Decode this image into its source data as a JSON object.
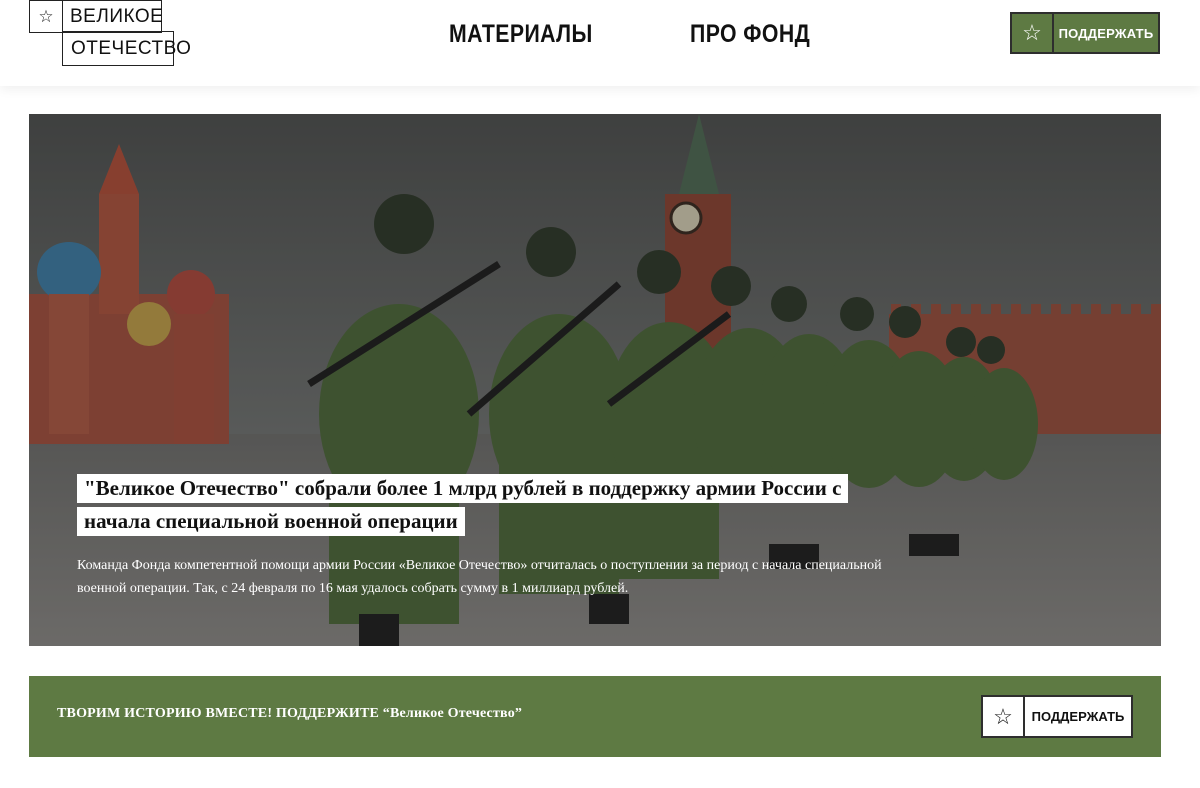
{
  "header": {
    "logo": {
      "line1": "ВЕЛИКОЕ",
      "line2": "ОТЕЧЕСТВО",
      "icon": "star-outline-icon"
    },
    "nav": [
      {
        "label": "МАТЕРИАЛЫ"
      },
      {
        "label": "ПРО ФОНД"
      }
    ],
    "support_button": {
      "icon": "star-outline-icon",
      "label": "ПОДДЕРЖАТЬ"
    }
  },
  "hero": {
    "title": "\"Великое Отечество\" собрали более 1 млрд рублей в поддержку армии России с начала специальной военной операции",
    "description": "Команда Фонда компетентной помощи армии России «Великое Отечество» отчиталась о поступлении за период с начала специальной военной операции. Так, с 24 февраля по 16 мая удалось собрать сумму в 1 миллиард рублей."
  },
  "banner": {
    "text": "ТВОРИМ ИСТОРИЮ ВМЕСТЕ! ПОДДЕРЖИТЕ “Великое Отечество”",
    "button": {
      "icon": "star-outline-icon",
      "label": "ПОДДЕРЖАТЬ"
    }
  },
  "colors": {
    "brand_green": "#5e7a43",
    "border_dark": "#2e2e2e",
    "background": "#ffffff"
  }
}
